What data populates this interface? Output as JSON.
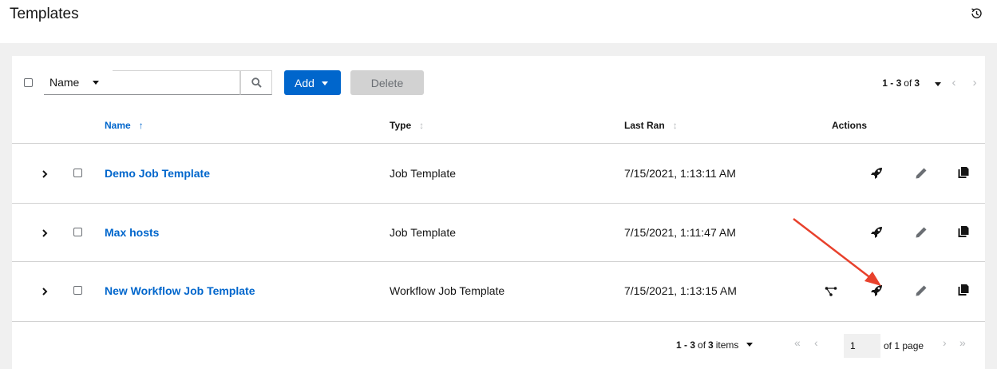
{
  "header": {
    "title": "Templates"
  },
  "toolbar": {
    "filter_label": "Name",
    "search_value": "",
    "add_label": "Add",
    "delete_label": "Delete",
    "pagination": {
      "range": "1 - 3",
      "of_text": "of",
      "total": "3"
    }
  },
  "columns": {
    "name": "Name",
    "type": "Type",
    "last_ran": "Last Ran",
    "actions": "Actions"
  },
  "rows": [
    {
      "name": "Demo Job Template",
      "type": "Job Template",
      "last_ran": "7/15/2021, 1:13:11 AM"
    },
    {
      "name": "Max hosts",
      "type": "Job Template",
      "last_ran": "7/15/2021, 1:11:47 AM"
    },
    {
      "name": "New Workflow Job Template",
      "type": "Workflow Job Template",
      "last_ran": "7/15/2021, 1:13:15 AM"
    }
  ],
  "footer": {
    "range": "1 - 3",
    "of_text": "of",
    "total": "3",
    "items_label": "items",
    "page_value": "1",
    "page_suffix": "of 1 page"
  },
  "colors": {
    "link": "#0066cc",
    "annotation_arrow": "#e8412c"
  }
}
